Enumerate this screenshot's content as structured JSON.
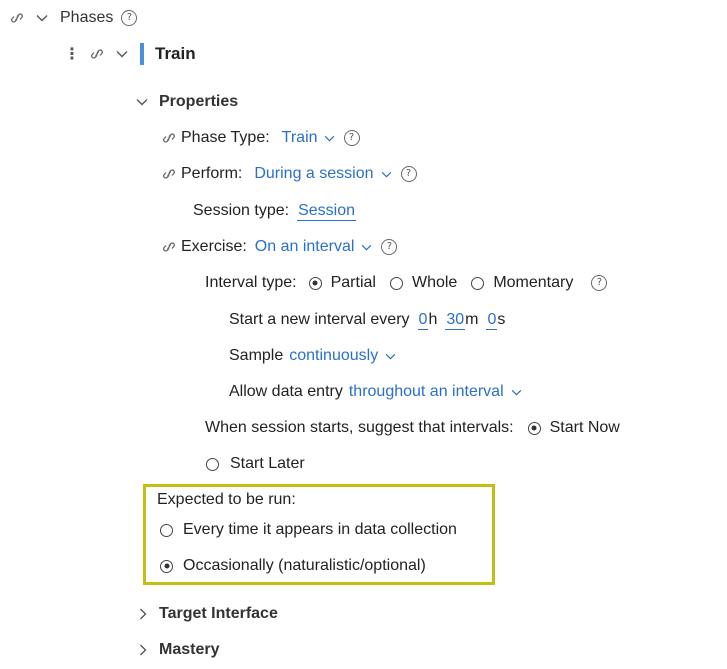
{
  "header": {
    "title": "Phases"
  },
  "phase": {
    "name": "Train"
  },
  "properties": {
    "title": "Properties",
    "phase_type_label": "Phase Type:",
    "phase_type_value": "Train",
    "perform_label": "Perform:",
    "perform_value": "During a session",
    "session_type_label": "Session type:",
    "session_type_value": "Session",
    "exercise_label": "Exercise:",
    "exercise_value": "On an interval",
    "interval_type_label": "Interval type:",
    "interval_options": [
      "Partial",
      "Whole",
      "Momentary"
    ],
    "interval_selected": "Partial",
    "new_interval_label": "Start a new interval every",
    "interval_hours": "0",
    "interval_hours_unit": "h",
    "interval_minutes": "30",
    "interval_minutes_unit": "m",
    "interval_seconds": "0",
    "interval_seconds_unit": "s",
    "sample_label": "Sample",
    "sample_value": "continuously",
    "allow_entry_label": "Allow data entry",
    "allow_entry_value": "throughout an interval",
    "session_starts_label": "When session starts, suggest that intervals:",
    "start_options": [
      "Start Now",
      "Start Later"
    ],
    "start_selected": "Start Now",
    "expected_label": "Expected to be run:",
    "expected_options": [
      "Every time it appears in data collection",
      "Occasionally (naturalistic/optional)"
    ],
    "expected_selected": "Occasionally (naturalistic/optional)"
  },
  "sections": {
    "target_interface": "Target Interface",
    "mastery": "Mastery"
  },
  "icons": {
    "help_glyph": "?",
    "kebab_glyph": "⋮"
  },
  "colors": {
    "link": "#2a6fc9",
    "phase_bar": "#4a90d9",
    "highlight_border": "#c3bd14"
  }
}
